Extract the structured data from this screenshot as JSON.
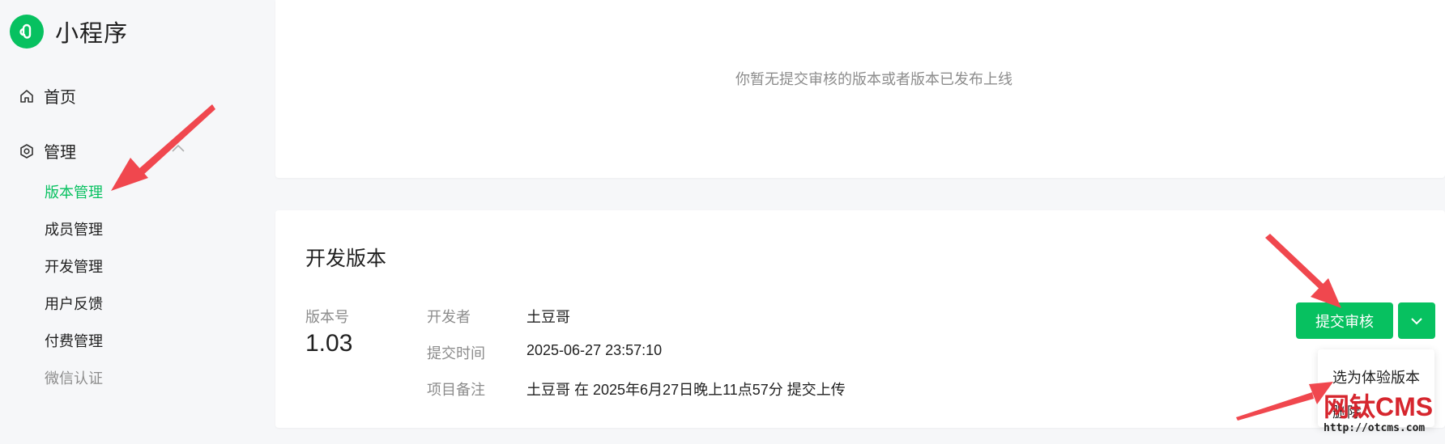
{
  "app": {
    "name": "小程序"
  },
  "sidebar": {
    "items": [
      {
        "label": "首页",
        "icon": "home-icon"
      },
      {
        "label": "管理",
        "icon": "settings-hexagon-icon"
      }
    ],
    "manage_sub": [
      {
        "label": "版本管理",
        "active": true
      },
      {
        "label": "成员管理"
      },
      {
        "label": "开发管理"
      },
      {
        "label": "用户反馈"
      },
      {
        "label": "付费管理"
      },
      {
        "label": "微信认证"
      }
    ]
  },
  "online_version": {
    "empty_text": "你暂无提交审核的版本或者版本已发布上线"
  },
  "dev_version": {
    "title": "开发版本",
    "version_label": "版本号",
    "version_number": "1.03",
    "fields": [
      {
        "key": "开发者",
        "value": "土豆哥"
      },
      {
        "key": "提交时间",
        "value": "2025-06-27 23:57:10"
      },
      {
        "key": "项目备注",
        "value": "土豆哥 在 2025年6月27日晚上11点57分 提交上传"
      }
    ],
    "submit_button": "提交审核",
    "dropdown_menu": [
      "选为体验版本",
      "删除"
    ]
  },
  "watermark": {
    "title": "网钛CMS",
    "url": "http://otcms.com"
  },
  "colors": {
    "accent": "#07c160",
    "annotation": "#f0474e",
    "muted_text": "#8c8c8c"
  }
}
